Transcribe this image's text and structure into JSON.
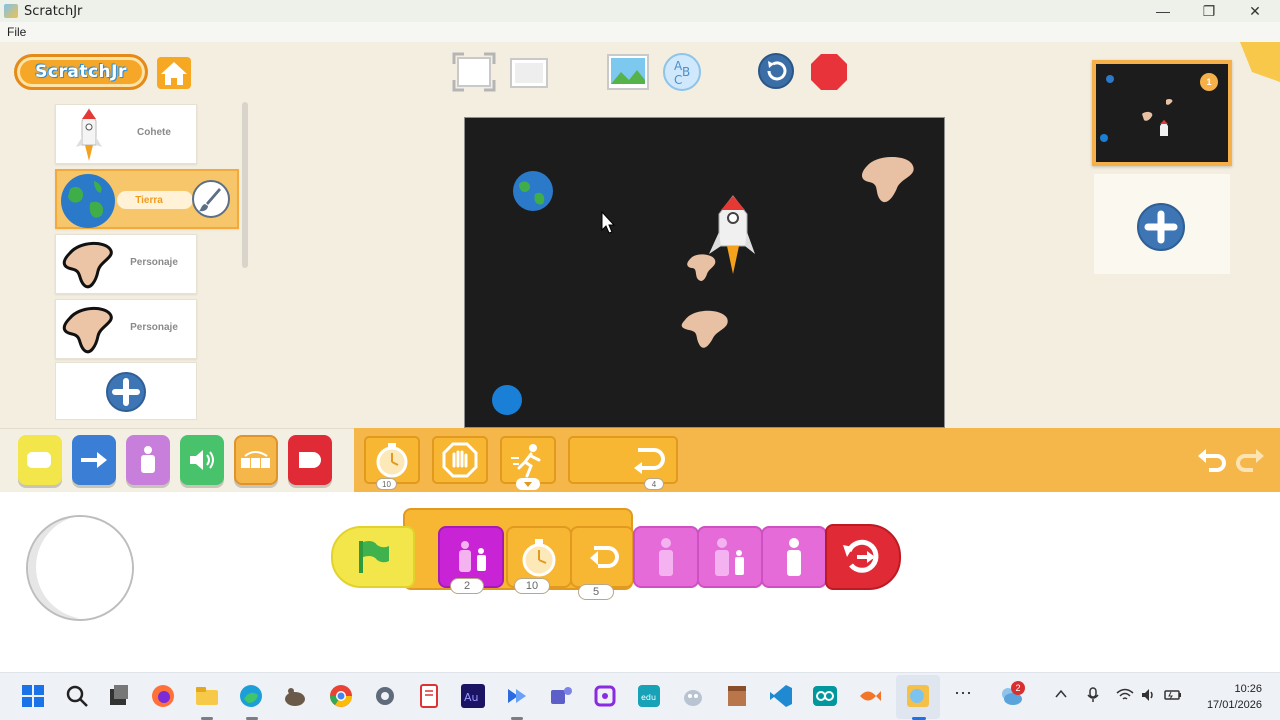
{
  "window": {
    "title": "ScratchJr",
    "minimize": "—",
    "maximize": "❐",
    "close": "✕"
  },
  "menu": {
    "file": "File"
  },
  "logo": {
    "text": "ScratchJr"
  },
  "sprites": [
    {
      "name": "Cohete",
      "selected": false
    },
    {
      "name": "Tierra",
      "selected": true
    },
    {
      "name": "Personaje",
      "selected": false
    },
    {
      "name": "Personaje",
      "selected": false
    }
  ],
  "pages": {
    "current_number": "1"
  },
  "palette": {
    "wait_param": "10",
    "repeat_param": "4"
  },
  "script": {
    "block_params": [
      "2",
      "10",
      "5"
    ]
  },
  "taskbar": {
    "time": "10:26",
    "date": "17/01/2026",
    "weather_badge": "2",
    "overflow": "⋯"
  },
  "colors": {
    "accent_orange": "#f5b64a",
    "control_yellow": "#f7b733",
    "looks_pink": "#e56bd9",
    "end_red": "#e02a35",
    "trigger_yellow": "#f2e64a",
    "motion_blue": "#3a7fd5",
    "sound_green": "#48c36c"
  },
  "icons": [
    "home-icon",
    "full-screen-icon",
    "grid-icon",
    "background-icon",
    "text-icon",
    "reset-icon",
    "stop-icon",
    "add-icon",
    "undo-icon",
    "redo-icon",
    "wait-icon",
    "stop-block-icon",
    "speed-icon",
    "repeat-icon",
    "green-flag-icon",
    "grow-icon",
    "shrink-icon",
    "show-icon",
    "repeat-forever-icon"
  ]
}
